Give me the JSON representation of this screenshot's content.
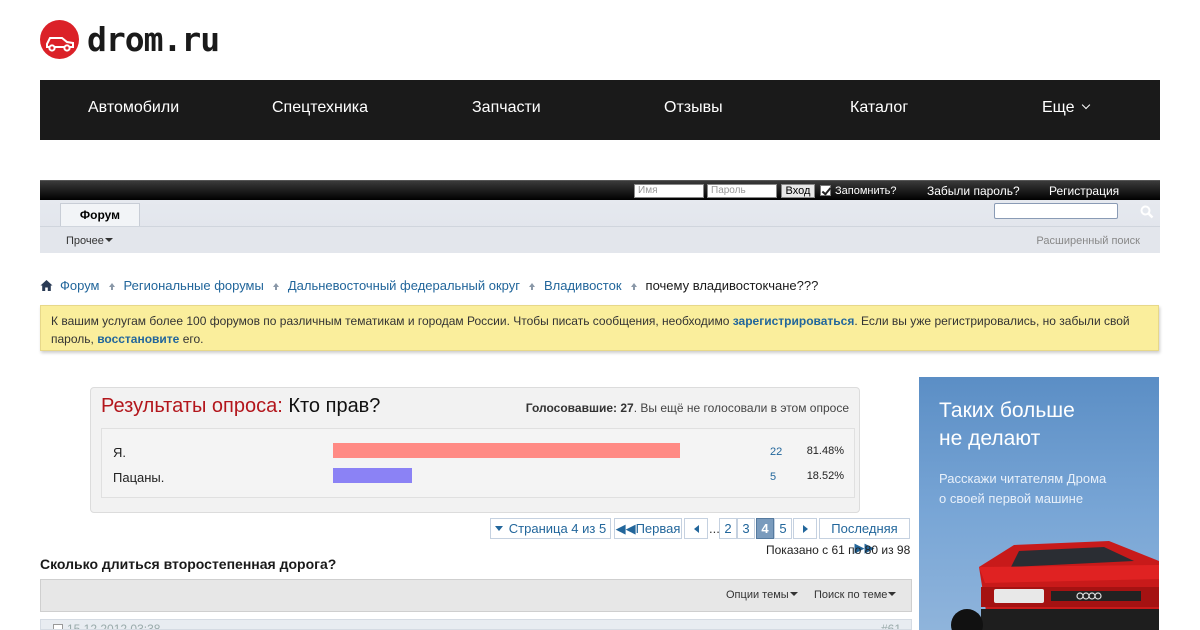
{
  "brand": {
    "name": "drom.ru"
  },
  "main_nav": {
    "items": [
      "Автомобили",
      "Спецтехника",
      "Запчасти",
      "Отзывы",
      "Каталог",
      "Еще"
    ]
  },
  "login": {
    "name_placeholder": "Имя",
    "password_placeholder": "Пароль",
    "login_button": "Вход",
    "remember_label": "Запомнить?",
    "remember_checked": true,
    "forgot_link": "Забыли пароль?",
    "register_link": "Регистрация"
  },
  "sub_nav": {
    "tab_forum": "Форум",
    "more_menu": "Прочее",
    "advanced_search": "Расширенный поиск",
    "search_value": ""
  },
  "breadcrumb": {
    "items": [
      "Форум",
      "Региональные форумы",
      "Дальневосточный федеральный округ",
      "Владивосток"
    ],
    "current": "почему владивостокчане???"
  },
  "notice": {
    "text_1": "К вашим услугам более 100 форумов по различным тематикам и городам России. Чтобы писать сообщения, необходимо ",
    "link_register": "зарегистрироваться",
    "text_2": ". Если вы уже регистрировались, но забыли свой пароль, ",
    "link_restore": "восстановите",
    "text_3": " его."
  },
  "poll": {
    "title_prefix": "Результаты опроса:",
    "question": "Кто прав?",
    "voters_label": "Голосовавшие:",
    "voters_count": "27",
    "voters_note": ". Вы ещё не голосовали в этом опросе",
    "options": [
      {
        "label": "Я.",
        "votes": "22",
        "percent": "81.48%",
        "share": 0.8148,
        "color": "#ff8a84"
      },
      {
        "label": "Пацаны.",
        "votes": "5",
        "percent": "18.52%",
        "share": 0.1852,
        "color": "#8b82f5"
      }
    ]
  },
  "pagination": {
    "page_info": "Страница 4 из 5",
    "first": "Первая",
    "dots": "...",
    "pages": [
      "2",
      "3",
      "4",
      "5"
    ],
    "current": "4",
    "last": "Последняя",
    "shown": "Показано с 61 по 80 из 98"
  },
  "thread": {
    "title": "Сколько длиться второстепенная дорога?",
    "options_menu": "Опции темы",
    "search_menu": "Поиск по теме",
    "post_date": "15.12.2012 03:38",
    "post_number": "#61"
  },
  "ad": {
    "headline_1": "Таких больше",
    "headline_2": "не делают",
    "sub_1": "Расскажи читателям Дрома",
    "sub_2": "о своей первой машине"
  }
}
